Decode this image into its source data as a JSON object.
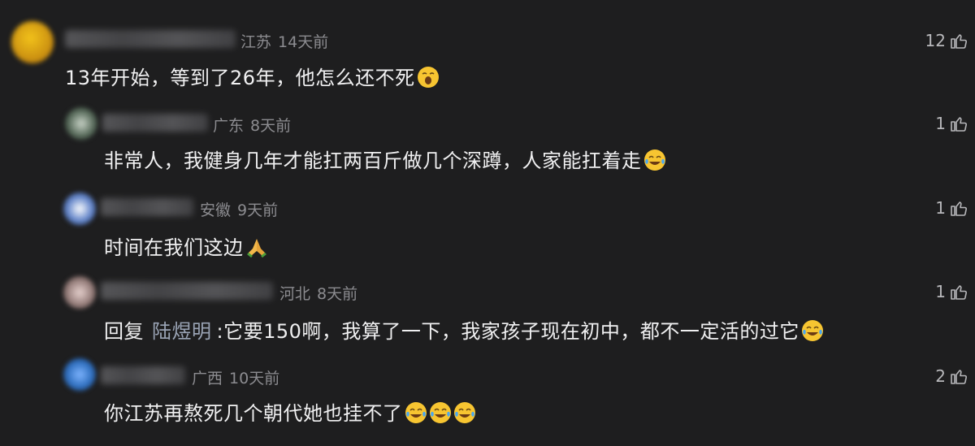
{
  "comments": [
    {
      "location": "江苏",
      "time": "14天前",
      "text": "13年开始，等到了26年，他怎么还不死",
      "emojis": [
        "yawning-face-icon"
      ],
      "likes": "12"
    },
    {
      "location": "广东",
      "time": "8天前",
      "text": "非常人，我健身几年才能扛两百斤做几个深蹲，人家能扛着走",
      "emojis": [
        "laughing-tears-icon"
      ],
      "likes": "1"
    },
    {
      "location": "安徽",
      "time": "9天前",
      "text": "时间在我们这边",
      "emojis": [
        "praying-hands-icon"
      ],
      "likes": "1"
    },
    {
      "location": "河北",
      "time": "8天前",
      "reply_prefix": "回复",
      "reply_to": "陆煜明",
      "text": ":它要150啊，我算了一下，我家孩子现在初中，都不一定活的过它",
      "emojis": [
        "laughing-tears-icon"
      ],
      "likes": "1"
    },
    {
      "location": "广西",
      "time": "10天前",
      "text": "你江苏再熬死几个朝代她也挂不了",
      "emojis": [
        "laughing-tears-icon",
        "laughing-tears-icon",
        "laughing-tears-icon"
      ],
      "likes": "2"
    }
  ]
}
